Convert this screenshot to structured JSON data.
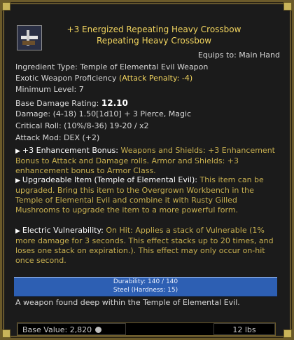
{
  "item": {
    "title_line1": "+3 Energized Repeating Heavy Crossbow",
    "title_line2": "Repeating Heavy Crossbow",
    "equips_to": "Equips to: Main Hand",
    "ingredient_type": "Ingredient Type: Temple of Elemental Evil Weapon",
    "proficiency": "Exotic Weapon Proficiency",
    "attack_penalty": "(Attack Penalty: -4)",
    "min_level": "Minimum Level: 7",
    "base_damage_label": "Base Damage Rating:",
    "base_damage_value": "12.10",
    "damage": "Damage: (4-18) 1.50[1d10] + 3 Pierce, Magic",
    "critical": "Critical Roll: (10%/8-36) 19-20 / x2",
    "attack_mod": "Attack Mod: DEX (+2)"
  },
  "effects": [
    {
      "head": "+3 Enhancement Bonus:",
      "body": "Weapons and Shields: +3 Enhancement Bonus to Attack and Damage rolls. Armor and Shields: +3 enhancement bonus to Armor Class."
    },
    {
      "head": "Upgradeable Item (Temple of Elemental Evil):",
      "body": "This item can be upgraded. Bring this item to the Overgrown Workbench in the Temple of Elemental Evil and combine it with Rusty Gilled Mushrooms to upgrade the item to a more powerful form."
    },
    {
      "head": "Electric Vulnerability:",
      "body": "On Hit: Applies a stack of Vulnerable (1% more damage for 3 seconds. This effect stacks up to 20 times, and loses one stack on expiration.). This effect may only occur on-hit once second."
    }
  ],
  "durability": {
    "text": "Durability: 140 / 140",
    "material": "Steel (Hardness: 15)",
    "fill_fraction": 1.0
  },
  "flavor": "A weapon found deep within the Temple of Elemental Evil.",
  "footer": {
    "base_value": "Base Value: 2,820",
    "weight": "12 lbs"
  },
  "icons": {
    "item_icon": "crossbow-icon",
    "coin_icon": "silver-coin-icon"
  }
}
